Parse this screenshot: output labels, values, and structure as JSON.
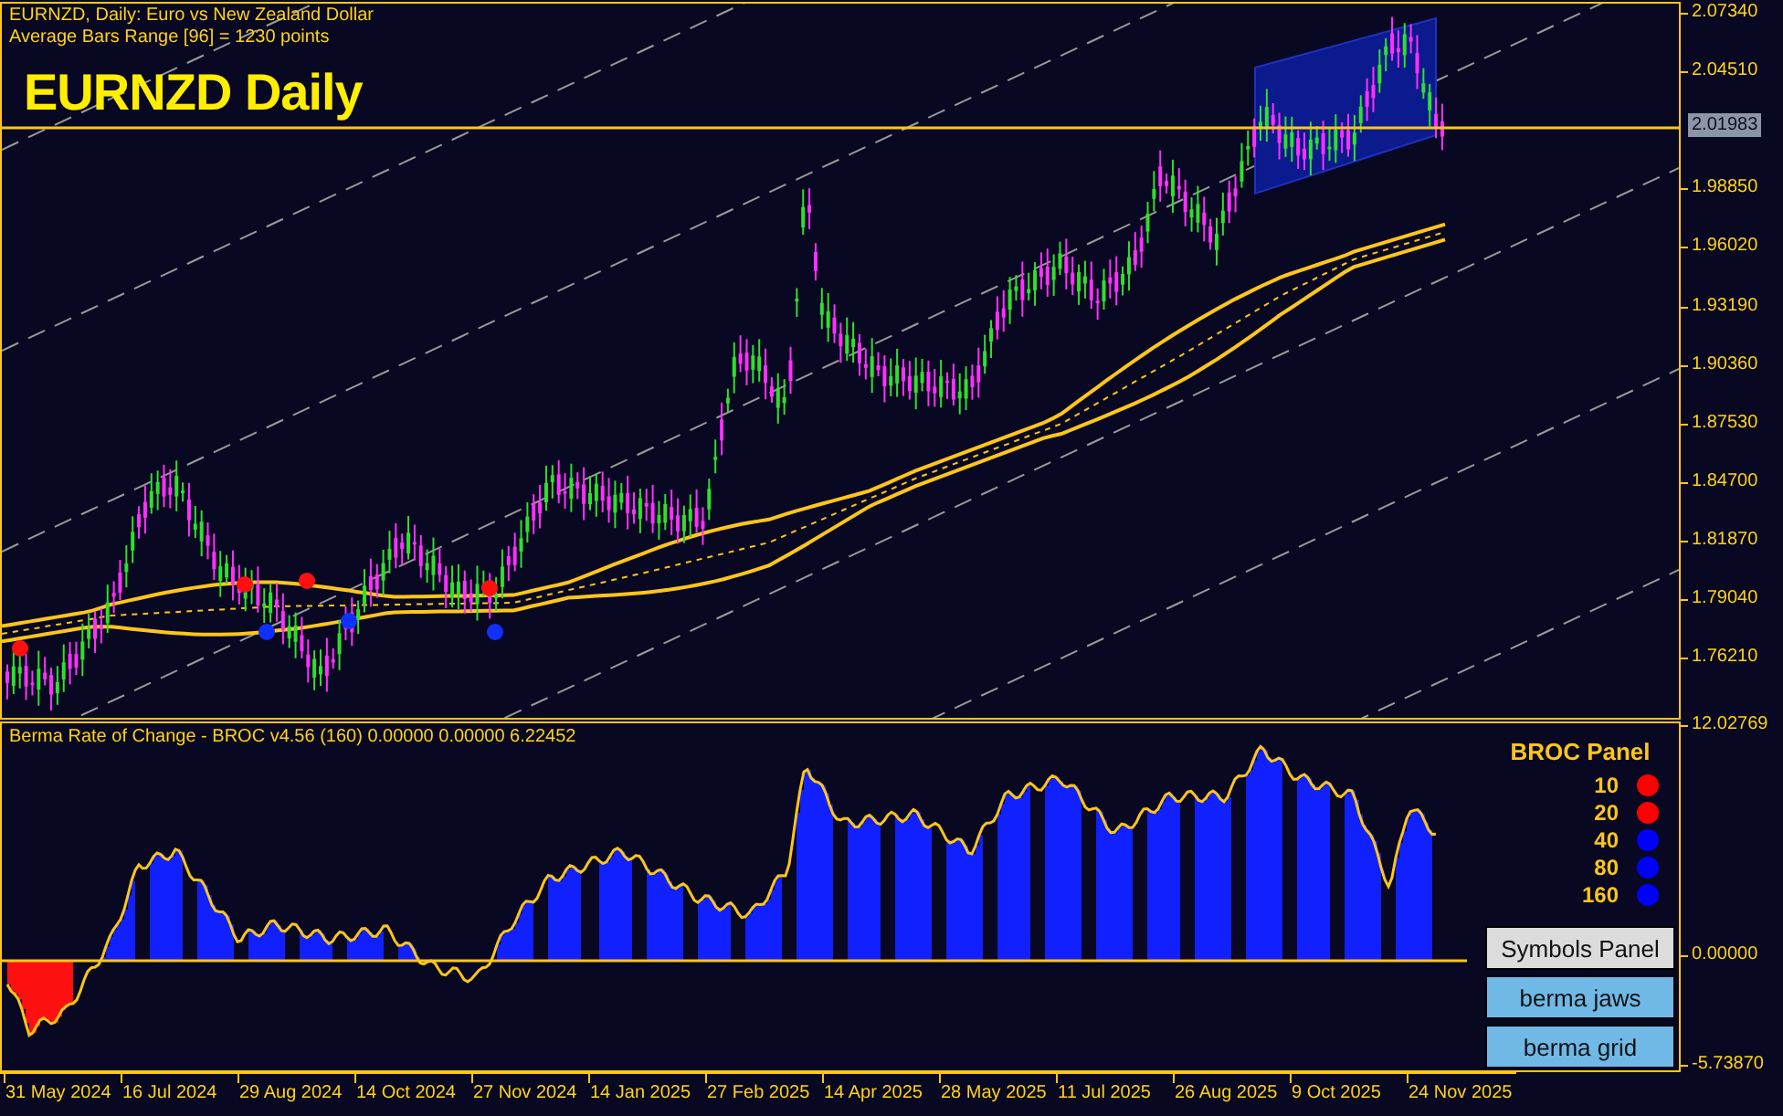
{
  "chart": {
    "symbol_line": "EURNZD, Daily:  Euro vs New Zealand Dollar",
    "range_line": "Average Bars Range [96] = 1230 points",
    "title": "EURNZD Daily",
    "price_ticks": [
      "2.07340",
      "2.04510",
      "1.98850",
      "1.96020",
      "1.93190",
      "1.90360",
      "1.87530",
      "1.84700",
      "1.81870",
      "1.79040",
      "1.76210"
    ],
    "current_price": "2.01983"
  },
  "indicator": {
    "title": "Berma Rate of Change - BROC v4.56 (160) 0.00000 0.00000 6.22452",
    "ticks": [
      "12.02769",
      "0.00000",
      "-5.73870"
    ],
    "panel": {
      "title": "BROC Panel",
      "periods": [
        {
          "label": "10",
          "color": "#ff0000"
        },
        {
          "label": "20",
          "color": "#ff0000"
        },
        {
          "label": "40",
          "color": "#0000ff"
        },
        {
          "label": "80",
          "color": "#0000ff"
        },
        {
          "label": "160",
          "color": "#0000ff"
        }
      ],
      "buttons": [
        {
          "label": "Symbols Panel",
          "kind": "light"
        },
        {
          "label": "berma jaws",
          "kind": "blue"
        },
        {
          "label": "berma grid",
          "kind": "blue"
        }
      ]
    }
  },
  "time_axis": [
    "31 May 2024",
    "16 Jul 2024",
    "29 Aug 2024",
    "14 Oct 2024",
    "27 Nov 2024",
    "14 Jan 2025",
    "27 Feb 2025",
    "14 Apr 2025",
    "28 May 2025",
    "11 Jul 2025",
    "26 Aug 2025",
    "9 Oct 2025",
    "24 Nov 2025"
  ]
}
